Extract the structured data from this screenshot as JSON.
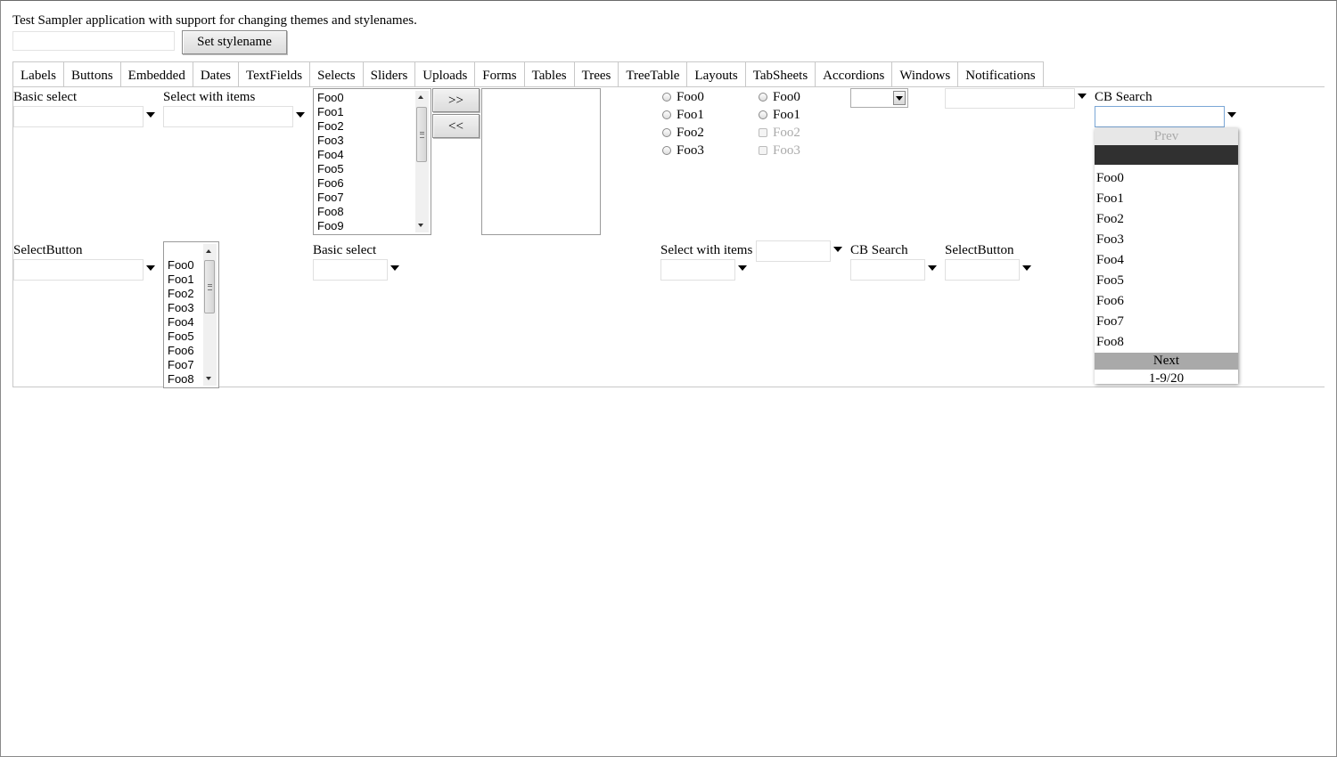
{
  "header": {
    "description": "Test Sampler application with support for changing themes and stylenames.",
    "stylename_input_value": "",
    "set_stylename_label": "Set stylename"
  },
  "tabs": [
    "Labels",
    "Buttons",
    "Embedded",
    "Dates",
    "TextFields",
    "Selects",
    "Sliders",
    "Uploads",
    "Forms",
    "Tables",
    "Trees",
    "TreeTable",
    "Layouts",
    "TabSheets",
    "Accordions",
    "Windows",
    "Notifications"
  ],
  "selected_tab": "Selects",
  "row1": {
    "basic_select_label": "Basic select",
    "select_with_items_label": "Select with items",
    "list_items": [
      "Foo0",
      "Foo1",
      "Foo2",
      "Foo3",
      "Foo4",
      "Foo5",
      "Foo6",
      "Foo7",
      "Foo8",
      "Foo9"
    ],
    "move_right_label": ">>",
    "move_left_label": "<<",
    "radio_group_a": [
      "Foo0",
      "Foo1",
      "Foo2",
      "Foo3"
    ],
    "radio_group_b": [
      "Foo0",
      "Foo1",
      "Foo2",
      "Foo3"
    ],
    "cb_search_label": "CB Search"
  },
  "row2": {
    "selectbutton_label": "SelectButton",
    "list_items": [
      "Foo0",
      "Foo1",
      "Foo2",
      "Foo3",
      "Foo4",
      "Foo5",
      "Foo6",
      "Foo7",
      "Foo8"
    ],
    "basic_select_label": "Basic select",
    "select_with_items_label": "Select with items",
    "cb_search_label": "CB Search",
    "selectbutton2_label": "SelectButton"
  },
  "popup": {
    "prev_label": "Prev",
    "items": [
      "Foo0",
      "Foo1",
      "Foo2",
      "Foo3",
      "Foo4",
      "Foo5",
      "Foo6",
      "Foo7",
      "Foo8"
    ],
    "next_label": "Next",
    "status": "1-9/20"
  }
}
